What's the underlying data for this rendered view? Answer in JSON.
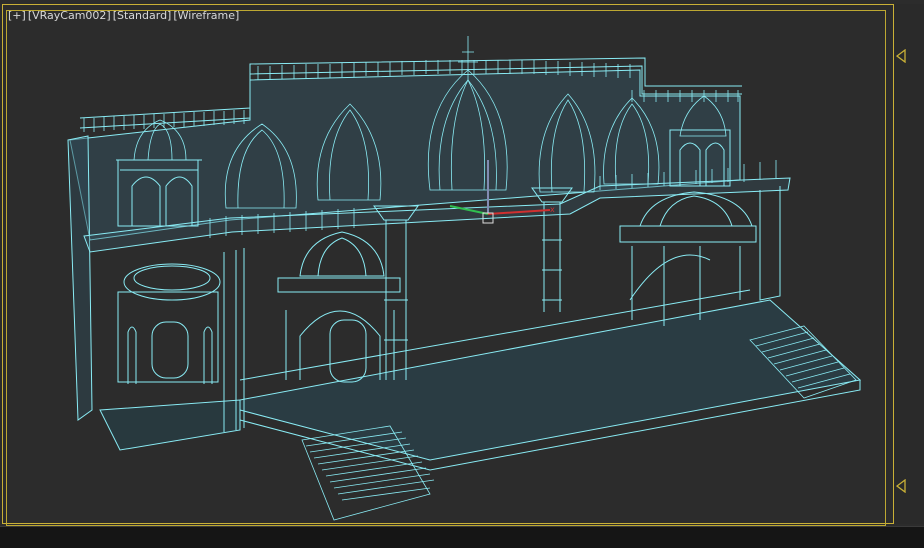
{
  "viewport": {
    "labels": [
      "[+]",
      "[VRayCam002]",
      "[Standard]",
      "[Wireframe]"
    ]
  },
  "colors": {
    "background": "#2c2c2c",
    "wire": "#8ff6ff",
    "wire_dim": "#5fd0e0",
    "frame": "#c9b036",
    "gizmo_x": "#d03030",
    "gizmo_y": "#30c050",
    "gizmo_z": "#4060ff"
  },
  "icons": {
    "safe_frame_top": "triangle-marker-icon",
    "safe_frame_bottom": "triangle-marker-icon",
    "gizmo": "transform-gizmo-icon"
  }
}
